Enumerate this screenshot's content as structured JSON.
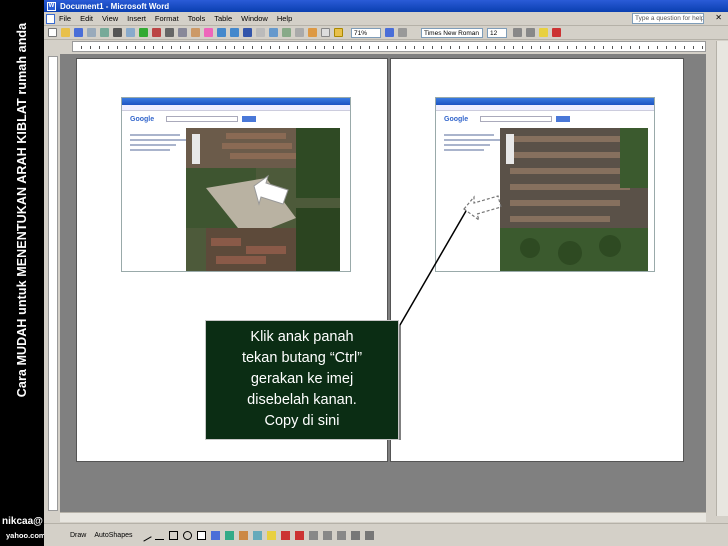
{
  "side": {
    "caption": "Cara MUDAH untuk MENENTUKAN ARAH KIBLAT rumah anda",
    "credit_name": "nikcaa@",
    "credit_site": "yahoo.com"
  },
  "window": {
    "title": "Document1 - Microsoft Word",
    "menu": [
      "File",
      "Edit",
      "View",
      "Insert",
      "Format",
      "Tools",
      "Table",
      "Window",
      "Help"
    ],
    "help_placeholder": "Type a question for help",
    "zoom": "71%",
    "font_name": "Times New Roman",
    "font_size": "12"
  },
  "drawing_toolbar": {
    "draw_label": "Draw",
    "autoshapes_label": "AutoShapes"
  },
  "callout": {
    "lines": [
      "Klik anak panah",
      "tekan butang “Ctrl”",
      "gerakan ke imej",
      "disebelah kanan.",
      "Copy di sini"
    ]
  },
  "colors": {
    "callout_bg": "#0b2d14",
    "titlebar": "#1d4fc4"
  }
}
